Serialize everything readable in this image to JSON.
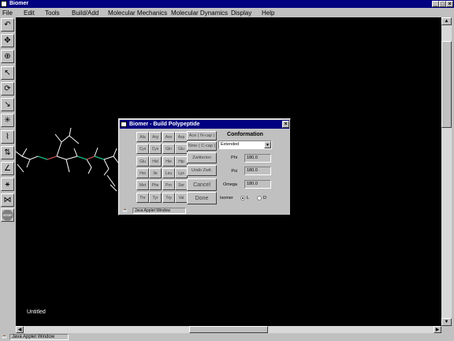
{
  "app": {
    "title": "Biomer"
  },
  "menu": [
    "File",
    "Edit",
    "Tools",
    "Build/Add",
    "Molecular Mechanics",
    "Molecular Dynamics",
    "Display",
    "Help"
  ],
  "toolbar": {
    "tools": [
      {
        "name": "undo-icon",
        "glyph": "↶"
      },
      {
        "name": "move-icon",
        "glyph": "✥"
      },
      {
        "name": "zoom-icon",
        "glyph": "🔍"
      },
      {
        "name": "select-arrow-icon",
        "glyph": "↖"
      },
      {
        "name": "rotate-icon",
        "glyph": "⟳"
      },
      {
        "name": "select-atom-icon",
        "glyph": "↘"
      },
      {
        "name": "select-residue-icon",
        "glyph": "✳"
      },
      {
        "name": "add-atom-icon",
        "glyph": "⌇"
      },
      {
        "name": "measure-distance-icon",
        "glyph": "⇅"
      },
      {
        "name": "measure-angle-icon",
        "glyph": "∠"
      },
      {
        "name": "torsion-icon",
        "glyph": "⚹"
      },
      {
        "name": "bond-tool-icon",
        "glyph": "⋈"
      }
    ],
    "stop_label": "STOP"
  },
  "canvas": {
    "document_name": "Untitled"
  },
  "status": {
    "applet_label": "Java Applet Window"
  },
  "dialog": {
    "title": "Biomer - Build Polypeptide",
    "amino_acids": [
      [
        "Ala",
        "Arg",
        "Asn",
        "Asp"
      ],
      [
        "Cys",
        "Cyx",
        "Gln",
        "Glu"
      ],
      [
        "Glu",
        "Hid",
        "Hie",
        "Hip"
      ],
      [
        "Hoi",
        "Ile",
        "Leu",
        "Lys"
      ],
      [
        "Met",
        "Phe",
        "Pro",
        "Ser"
      ],
      [
        "Thr",
        "Tyr",
        "Trp",
        "Val"
      ]
    ],
    "actions": [
      "Ace ( N-cap )",
      "Nme ( C-cap )",
      "Zwitterion",
      "Undo Zwit.",
      "Cancel",
      "Done"
    ],
    "conformation": {
      "heading": "Conformation",
      "preset": "Extended",
      "phi_label": "Phi",
      "phi": "180.0",
      "psi_label": "Psi",
      "psi": "180.0",
      "omega_label": "Omega",
      "omega": "180.0",
      "isomer_label": "Isomer",
      "isomer_options": [
        "L",
        "D"
      ],
      "isomer_selected": "L"
    },
    "applet_label": "Java Applet Window"
  },
  "colors": {
    "titlebar": "#000080",
    "canvas": "#000000",
    "chrome": "#c0c0c0",
    "molecule_bond": "#ffffff",
    "molecule_accent": "#00c080"
  }
}
